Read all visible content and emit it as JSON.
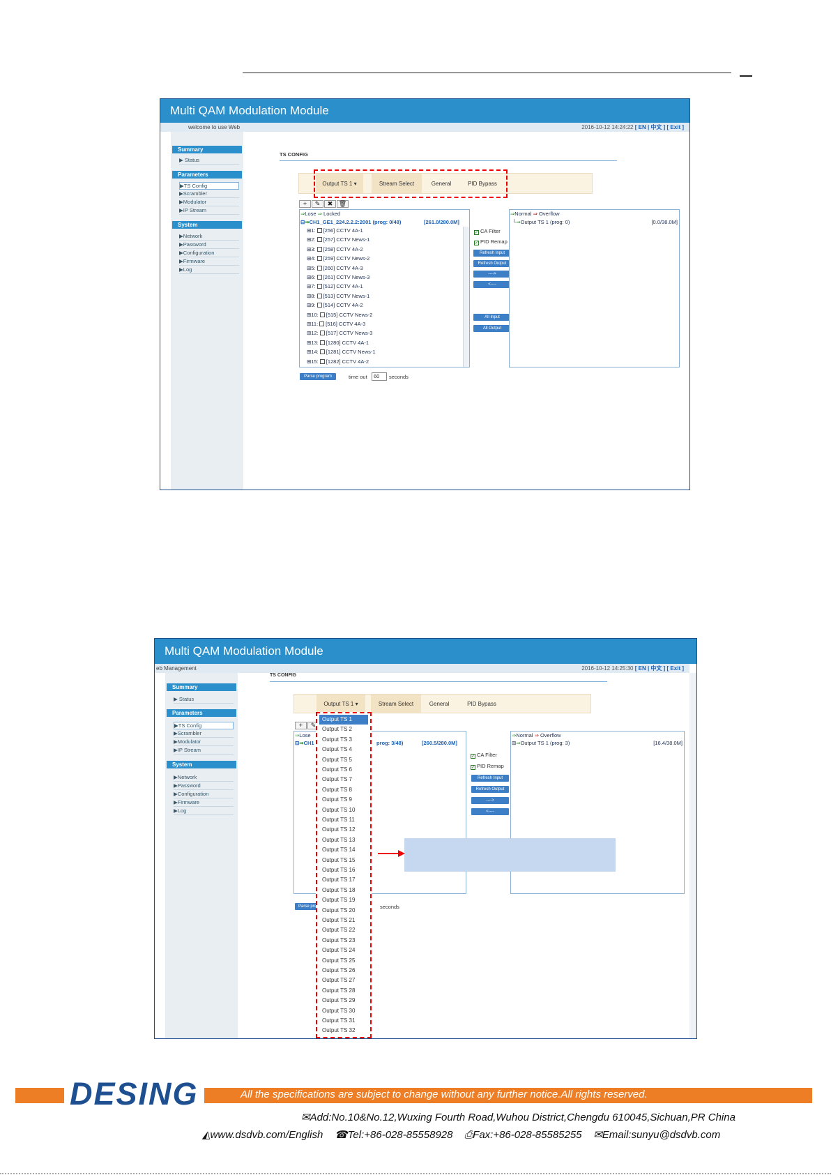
{
  "screen1": {
    "app_title": "Multi QAM Modulation Module",
    "welcome": "welcome to use Web",
    "datetime": "2016-10-12 14:24:22",
    "lang": "[ EN | 中文 ]",
    "exit": "[ Exit ]",
    "sidebar": {
      "summary": "Summary",
      "status": "Status",
      "parameters": "Parameters",
      "ts_config": "TS Config",
      "scrambler": "Scrambler",
      "modulator": "Modulator",
      "ip_stream": "IP Stream",
      "system": "System",
      "network": "Network",
      "password": "Password",
      "configuration": "Configuration",
      "firmware": "Firmware",
      "log": "Log"
    },
    "page_title": "TS CONFIG",
    "tabs": [
      "Output TS 1 ▾",
      "Stream Select",
      "General",
      "PID Bypass"
    ],
    "legend_left": [
      "Lose",
      "Locked"
    ],
    "channel": "CH1_GE1_224.2.2.2:2001 (prog: 0/48)",
    "channel_rate": "[261.0/280.0M]",
    "programs": [
      "1: [256] CCTV 4A-1",
      "2: [257] CCTV News-1",
      "3: [258] CCTV 4A-2",
      "4: [259] CCTV News-2",
      "5: [260] CCTV 4A-3",
      "6: [261] CCTV News-3",
      "7: [512] CCTV 4A-1",
      "8: [513] CCTV News-1",
      "9: [514] CCTV 4A-2",
      "10: [515] CCTV News-2",
      "11: [516] CCTV 4A-3",
      "12: [517] CCTV News-3",
      "13: [1280] CCTV 4A-1",
      "14: [1281] CCTV News-1",
      "15: [1282] CCTV 4A-2"
    ],
    "ca_filter": "CA Filter",
    "pid_remap": "PID Remap",
    "btn_refresh_input": "Refresh Input",
    "btn_refresh_output": "Refresh Output",
    "btn_right": "---->",
    "btn_left": "<----",
    "btn_all_input": "All Input",
    "btn_all_output": "All Output",
    "legend_right": [
      "Normal",
      "Overflow"
    ],
    "output": "Output TS 1 (prog: 0)",
    "output_rate": "[0.0/38.0M]",
    "parse_btn": "Parse program",
    "timeout_label": "time out",
    "timeout_value": "60",
    "seconds": "seconds"
  },
  "screen2": {
    "app_title": "Multi QAM Modulation Module",
    "welcome": "eb Management",
    "datetime": "2016-10-12 14:25:30",
    "lang": "[ EN | 中文 ]",
    "exit": "[ Exit ]",
    "page_title": "TS CONFIG",
    "tabs": [
      "Output TS 1 ▾",
      "Stream Select",
      "General",
      "PID Bypass"
    ],
    "legend_left": "Lose",
    "channel": "CH1",
    "channel_mid": "prog: 3/48)",
    "channel_rate": "[260.5/280.0M]",
    "ca_filter": "CA Filter",
    "pid_remap": "PID Remap",
    "btn_refresh_input": "Refresh Input",
    "btn_refresh_output": "Refresh Output",
    "btn_right": "---->",
    "btn_left": "<----",
    "legend_right": [
      "Normal",
      "Overflow"
    ],
    "output": "Output TS 1 (prog: 3)",
    "output_rate": "[16.4/38.0M]",
    "parse_btn": "Parse pro",
    "seconds": "seconds",
    "dropdown": [
      "Output TS 1",
      "Output TS 2",
      "Output TS 3",
      "Output TS 4",
      "Output TS 5",
      "Output TS 6",
      "Output TS 7",
      "Output TS 8",
      "Output TS 9",
      "Output TS 10",
      "Output TS 11",
      "Output TS 12",
      "Output TS 13",
      "Output TS 14",
      "Output TS 15",
      "Output TS 16",
      "Output TS 17",
      "Output TS 18",
      "Output TS 19",
      "Output TS 20",
      "Output TS 21",
      "Output TS 22",
      "Output TS 23",
      "Output TS 24",
      "Output TS 25",
      "Output TS 26",
      "Output TS 27",
      "Output TS 28",
      "Output TS 29",
      "Output TS 30",
      "Output TS 31",
      "Output TS 32"
    ]
  },
  "footer": {
    "logo": "DESING",
    "slogan": "All the specifications are subject to change without any further notice.All rights reserved.",
    "address": "Add:No.10&No.12,Wuxing Fourth Road,Wuhou District,Chengdu 610045,Sichuan,PR China",
    "web": "www.dsdvb.com/English",
    "tel": "Tel:+86-028-85558928",
    "fax": "Fax:+86-028-85585255",
    "email": "Email:sunyu@dsdvb.com"
  },
  "colors": {
    "header_blue": "#2b8fcb",
    "accent_orange": "#ee7e26",
    "dash_red": "#e00000",
    "logo_blue": "#1d4f91"
  }
}
